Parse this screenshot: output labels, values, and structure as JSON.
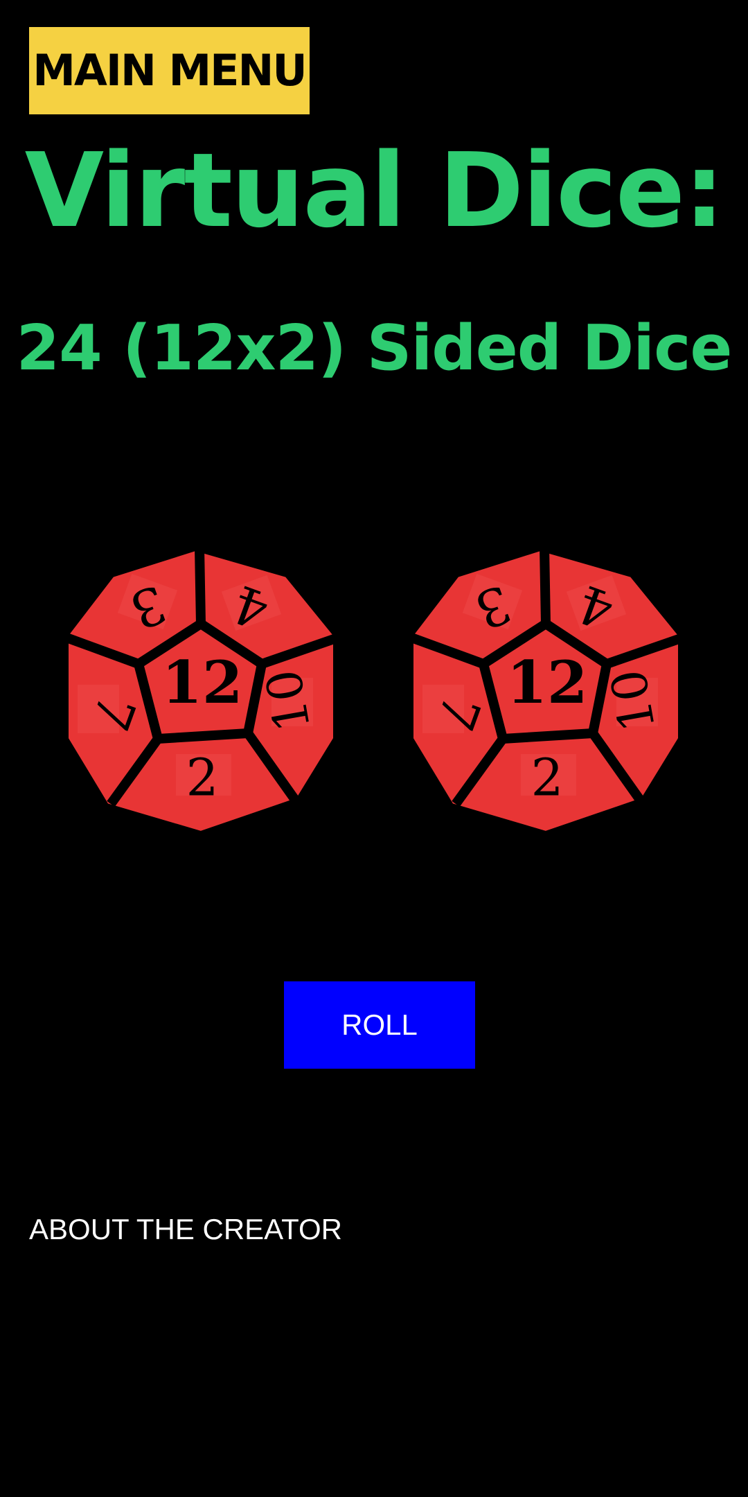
{
  "header": {
    "main_menu_label": "MAIN MENU"
  },
  "title": "Virtual Dice:",
  "subtitle": "24 (12x2) Sided Dice",
  "dice": [
    {
      "center_value": "12",
      "faces": [
        "3",
        "4",
        "10",
        "2",
        "7"
      ],
      "color": "#e83535"
    },
    {
      "center_value": "12",
      "faces": [
        "3",
        "4",
        "10",
        "2",
        "7"
      ],
      "color": "#e83535"
    }
  ],
  "actions": {
    "roll_label": "ROLL",
    "about_label": "ABOUT THE CREATOR"
  },
  "colors": {
    "background": "#000000",
    "menu_bg": "#f5d142",
    "title": "#2ecc71",
    "roll_bg": "#0000ff",
    "die_red": "#e83535",
    "die_line": "#000000"
  }
}
